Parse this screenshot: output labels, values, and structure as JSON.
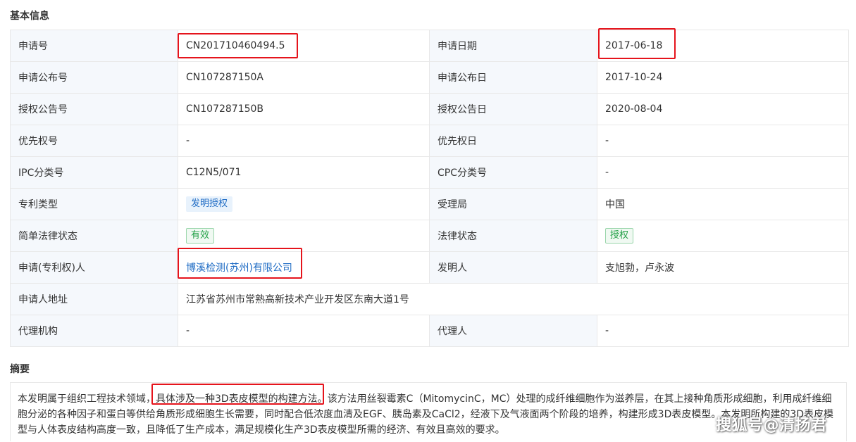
{
  "section_basic": "基本信息",
  "section_abstract": "摘要",
  "rows": [
    {
      "l1": "申请号",
      "v1": "CN201710460494.5",
      "l2": "申请日期",
      "v2": "2017-06-18"
    },
    {
      "l1": "申请公布号",
      "v1": "CN107287150A",
      "l2": "申请公布日",
      "v2": "2017-10-24"
    },
    {
      "l1": "授权公告号",
      "v1": "CN107287150B",
      "l2": "授权公告日",
      "v2": "2020-08-04"
    },
    {
      "l1": "优先权号",
      "v1": "-",
      "l2": "优先权日",
      "v2": "-"
    },
    {
      "l1": "IPC分类号",
      "v1": "C12N5/071",
      "l2": "CPC分类号",
      "v2": "-"
    },
    {
      "l1": "专利类型",
      "v1": "发明授权",
      "l2": "受理局",
      "v2": "中国"
    },
    {
      "l1": "简单法律状态",
      "v1": "有效",
      "l2": "法律状态",
      "v2": "授权"
    },
    {
      "l1": "申请(专利权)人",
      "v1": "博溪检测(苏州)有限公司",
      "l2": "发明人",
      "v2": "支旭勃，卢永波"
    },
    {
      "l1": "申请人地址",
      "v1": "江苏省苏州市常熟高新技术产业开发区东南大道1号"
    },
    {
      "l1": "代理机构",
      "v1": "-",
      "l2": "代理人",
      "v2": "-"
    }
  ],
  "abstract": {
    "part1": "本发明属于组织工程技术领域，",
    "highlight": "具体涉及一种3D表皮模型的构建方法。",
    "part2": "该方法用丝裂霉素C（MitomycinC，MC）处理的成纤维细胞作为滋养层，在其上接种角质形成细胞，利用成纤维细胞分泌的各种因子和蛋白等供给角质形成细胞生长需要，同时配合低浓度血清及EGF、胰岛素及CaCl2，经液下及气液面两个阶段的培养，构建形成3D表皮模型。本发明所构建的3D表皮模型与人体表皮结构高度一致，且降低了生产成本，满足规模化生产3D表皮模型所需的经济、有效且高效的要求。"
  },
  "watermark": "搜狐号@清扬君",
  "colors": {
    "label_bg": "#f5f8fc",
    "border": "#e8e8e8",
    "link": "#1e6bc4",
    "green_tag": "#22a046",
    "highlight_box": "#e5141c"
  }
}
